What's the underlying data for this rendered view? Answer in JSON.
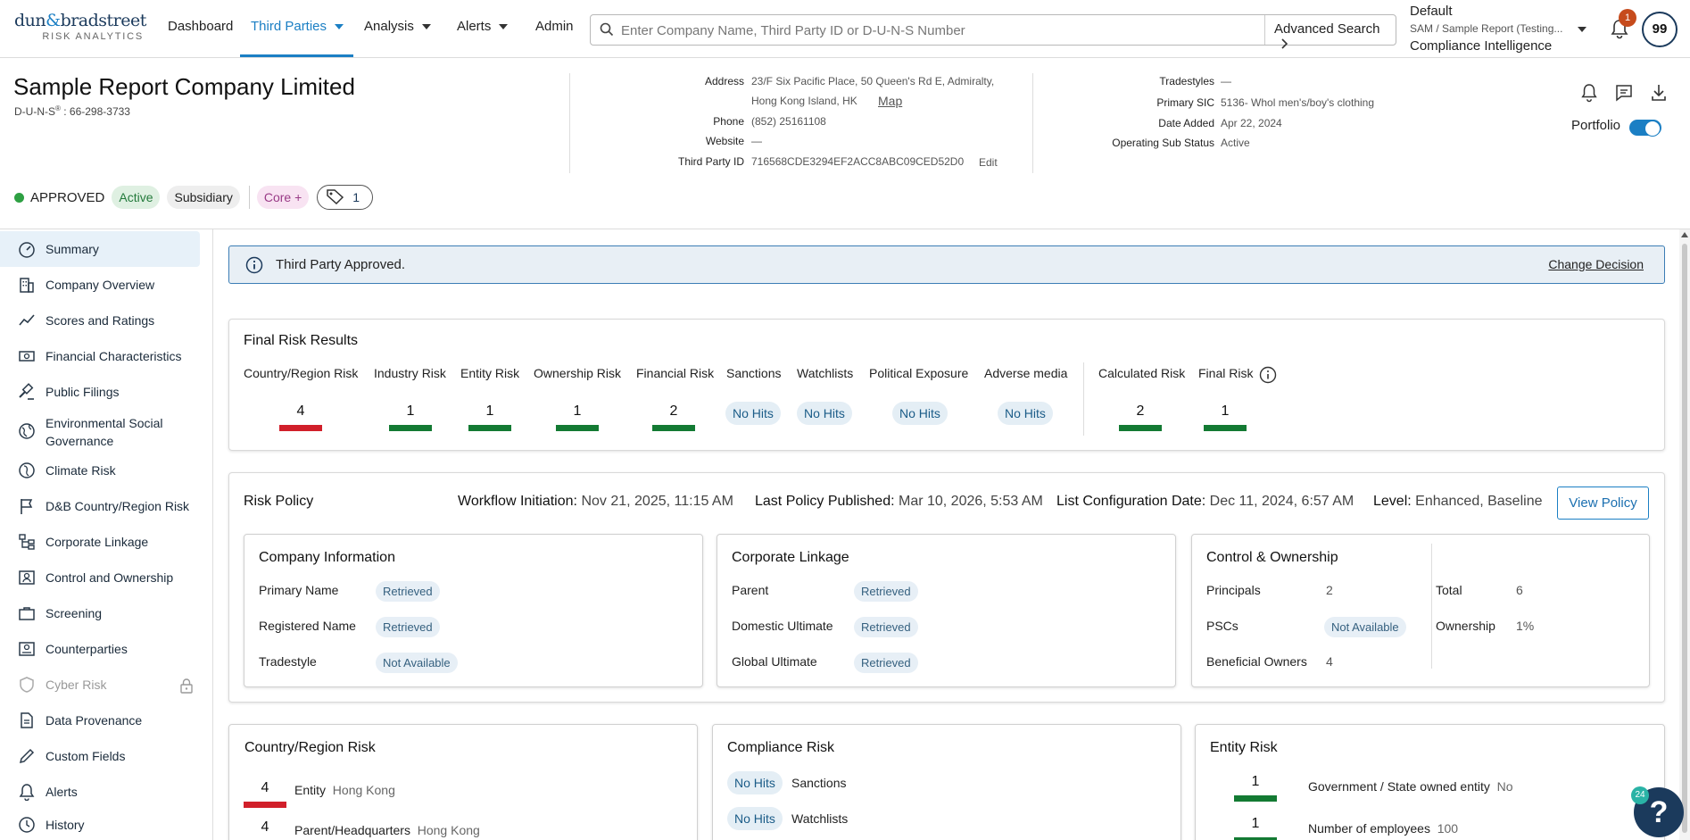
{
  "logo": {
    "line1_a": "dun",
    "line1_amp": "&",
    "line1_b": "bradstreet",
    "line2": "RISK ANALYTICS"
  },
  "nav": {
    "dashboard": "Dashboard",
    "third_parties": "Third Parties",
    "analysis": "Analysis",
    "alerts": "Alerts",
    "admin": "Admin"
  },
  "search": {
    "placeholder": "Enter Company Name, Third Party ID or D-U-N-S Number",
    "advanced": "Advanced Search"
  },
  "account": {
    "profile": "Default",
    "context": "SAM / Sample Report (Testing...",
    "product": "Compliance Intelligence",
    "notification_count": "1",
    "avatar_initials": "99"
  },
  "company": {
    "name": "Sample Report Company Limited",
    "duns_label": "D-U-N-S",
    "duns_reg": "®",
    "duns_value": " : 66-298-3733",
    "address_label": "Address",
    "address_line1": "23/F Six Pacific Place, 50 Queen's Rd E, Admiralty,",
    "address_line2": "Hong Kong Island, HK",
    "map_link": "Map",
    "phone_label": "Phone",
    "phone": "(852) 25161108",
    "website_label": "Website",
    "website": "—",
    "tpid_label": "Third Party ID",
    "tpid": "716568CDE3294EF2ACC8ABC09CED52D0",
    "edit_link": "Edit",
    "tradestyles_label": "Tradestyles",
    "tradestyles": "—",
    "sic_label": "Primary SIC",
    "sic": "5136- Whol men's/boy's clothing",
    "date_added_label": "Date Added",
    "date_added": "Apr 22, 2024",
    "op_status_label": "Operating Sub Status",
    "op_status": "Active",
    "portfolio_label": "Portfolio",
    "portfolio_on": true
  },
  "status": {
    "decision": "APPROVED",
    "active": "Active",
    "subsidiary": "Subsidiary",
    "core": "Core +",
    "tag_count": "1"
  },
  "sidebar": {
    "items": [
      {
        "label": "Summary",
        "icon": "gauge-icon"
      },
      {
        "label": "Company Overview",
        "icon": "building-icon"
      },
      {
        "label": "Scores and Ratings",
        "icon": "trend-line-icon"
      },
      {
        "label": "Financial Characteristics",
        "icon": "money-icon"
      },
      {
        "label": "Public Filings",
        "icon": "gavel-icon"
      },
      {
        "label": "Environmental Social",
        "label2": "Governance",
        "icon": "globe-icon"
      },
      {
        "label": "Climate Risk",
        "icon": "globe-leaf-icon"
      },
      {
        "label": "D&B Country/Region Risk",
        "icon": "flag-icon"
      },
      {
        "label": "Corporate Linkage",
        "icon": "hierarchy-icon"
      },
      {
        "label": "Control and Ownership",
        "icon": "person-id-icon"
      },
      {
        "label": "Screening",
        "icon": "briefcase-icon"
      },
      {
        "label": "Counterparties",
        "icon": "person-card-icon"
      },
      {
        "label": "Cyber Risk",
        "icon": "shield-icon"
      },
      {
        "label": "Data Provenance",
        "icon": "document-icon"
      },
      {
        "label": "Custom Fields",
        "icon": "pencil-icon"
      },
      {
        "label": "Alerts",
        "icon": "bell-icon"
      },
      {
        "label": "History",
        "icon": "clock-icon"
      }
    ]
  },
  "banner": {
    "text": "Third Party Approved.",
    "action": "Change Decision"
  },
  "final_risk": {
    "title": "Final Risk Results",
    "headers": {
      "country": "Country/Region Risk",
      "industry": "Industry Risk",
      "entity": "Entity Risk",
      "ownership": "Ownership Risk",
      "financial": "Financial Risk",
      "sanctions": "Sanctions",
      "watchlists": "Watchlists",
      "political": "Political Exposure",
      "adverse": "Adverse media",
      "calculated": "Calculated Risk",
      "final": "Final Risk"
    },
    "values": {
      "country": "4",
      "industry": "1",
      "entity": "1",
      "ownership": "1",
      "financial": "2",
      "sanctions": "No Hits",
      "watchlists": "No Hits",
      "political": "No Hits",
      "adverse": "No Hits",
      "calculated": "2",
      "final": "1"
    },
    "colors": {
      "high": "#d11f2a",
      "low": "#137a33"
    }
  },
  "risk_policy": {
    "title": "Risk Policy",
    "workflow_label": "Workflow Initiation:",
    "workflow_value": "Nov 21, 2025, 11:15 AM",
    "published_label": "Last Policy Published:",
    "published_value": "Mar 10, 2026, 5:53 AM",
    "listconfig_label": "List Configuration Date:",
    "listconfig_value": "Dec 11, 2024, 6:57 AM",
    "level_label": "Level:",
    "level_value": "Enhanced, Baseline",
    "view_button": "View Policy",
    "company_info": {
      "title": "Company Information",
      "rows": [
        {
          "label": "Primary Name",
          "value": "Retrieved"
        },
        {
          "label": "Registered Name",
          "value": "Retrieved"
        },
        {
          "label": "Tradestyle",
          "value": "Not Available"
        }
      ]
    },
    "corporate_linkage": {
      "title": "Corporate Linkage",
      "rows": [
        {
          "label": "Parent",
          "value": "Retrieved"
        },
        {
          "label": "Domestic Ultimate",
          "value": "Retrieved"
        },
        {
          "label": "Global Ultimate",
          "value": "Retrieved"
        }
      ]
    },
    "control_ownership": {
      "title": "Control & Ownership",
      "principals_label": "Principals",
      "principals": "2",
      "pscs_label": "PSCs",
      "pscs": "Not Available",
      "beneficial_label": "Beneficial Owners",
      "beneficial": "4",
      "total_label": "Total",
      "total": "6",
      "ownership_label": "Ownership",
      "ownership": "1%"
    }
  },
  "country_risk": {
    "title": "Country/Region Risk",
    "rows": [
      {
        "value": "4",
        "label": "Entity",
        "detail": "Hong Kong"
      },
      {
        "value": "4",
        "label": "Parent/Headquarters",
        "detail": "Hong Kong"
      }
    ]
  },
  "compliance_risk": {
    "title": "Compliance Risk",
    "rows": [
      {
        "value": "No Hits",
        "label": "Sanctions"
      },
      {
        "value": "No Hits",
        "label": "Watchlists"
      }
    ]
  },
  "entity_risk": {
    "title": "Entity Risk",
    "rows": [
      {
        "value": "1",
        "label": "Government / State owned entity",
        "detail": "No"
      },
      {
        "value": "1",
        "label": "Number of employees",
        "detail": "100"
      }
    ]
  },
  "help": {
    "badge": "24",
    "symbol": "?"
  }
}
